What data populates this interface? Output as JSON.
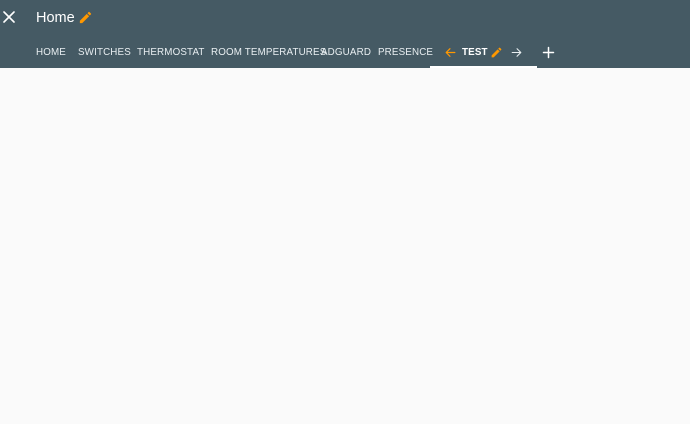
{
  "header": {
    "title": "Home",
    "close_icon": "close-icon",
    "edit_icon": "pencil-icon"
  },
  "tabs": [
    {
      "label": "HOME"
    },
    {
      "label": "SWITCHES"
    },
    {
      "label": "THERMOSTAT"
    },
    {
      "label": "ROOM TEMPERATURES"
    },
    {
      "label": "ADGUARD"
    },
    {
      "label": "PRESENCE"
    }
  ],
  "active_tab": {
    "label": "TEST",
    "move_left_icon": "arrow-left-icon",
    "edit_icon": "pencil-icon",
    "move_right_icon": "arrow-right-icon"
  },
  "add_tab_icon": "plus-icon",
  "colors": {
    "header_bg": "#455a64",
    "accent": "#ff9800",
    "page_bg": "#fafafa",
    "tab_text": "#e8eef1"
  }
}
